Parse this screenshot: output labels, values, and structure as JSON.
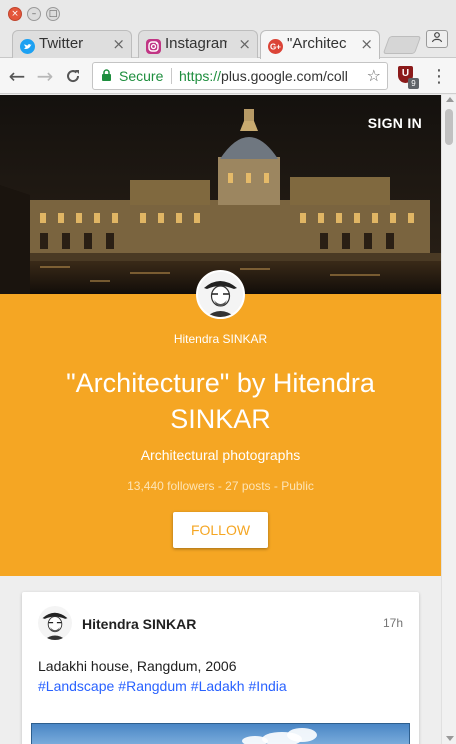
{
  "browser": {
    "tabs": [
      {
        "title": "Twitter",
        "favicon": "twitter-icon",
        "favicon_color": "#1da1f2"
      },
      {
        "title": "Instagram",
        "favicon": "instagram-icon",
        "favicon_color": "#c13584"
      },
      {
        "title": "\"Architec",
        "favicon": "google-plus-icon",
        "favicon_color": "#db4437",
        "active": true
      }
    ],
    "address": {
      "secure_label": "Secure",
      "scheme": "https://",
      "host_path": "plus.google.com/coll"
    },
    "extension_badge": "9"
  },
  "page": {
    "sign_in": "SIGN IN",
    "owner_name": "Hitendra SINKAR",
    "collection_title": "\"Architecture\" by Hitendra SINKAR",
    "collection_description": "Architectural photographs",
    "collection_stats": "13,440 followers - 27 posts - Public",
    "follow_label": "FOLLOW",
    "accent_color": "#f5a623"
  },
  "post": {
    "author": "Hitendra SINKAR",
    "time": "17h",
    "text": "Ladakhi house, Rangdum, 2006",
    "tags": [
      "#Landscape",
      "#Rangdum",
      "#Ladakh",
      "#India"
    ],
    "tag_color": "#2962ff"
  }
}
